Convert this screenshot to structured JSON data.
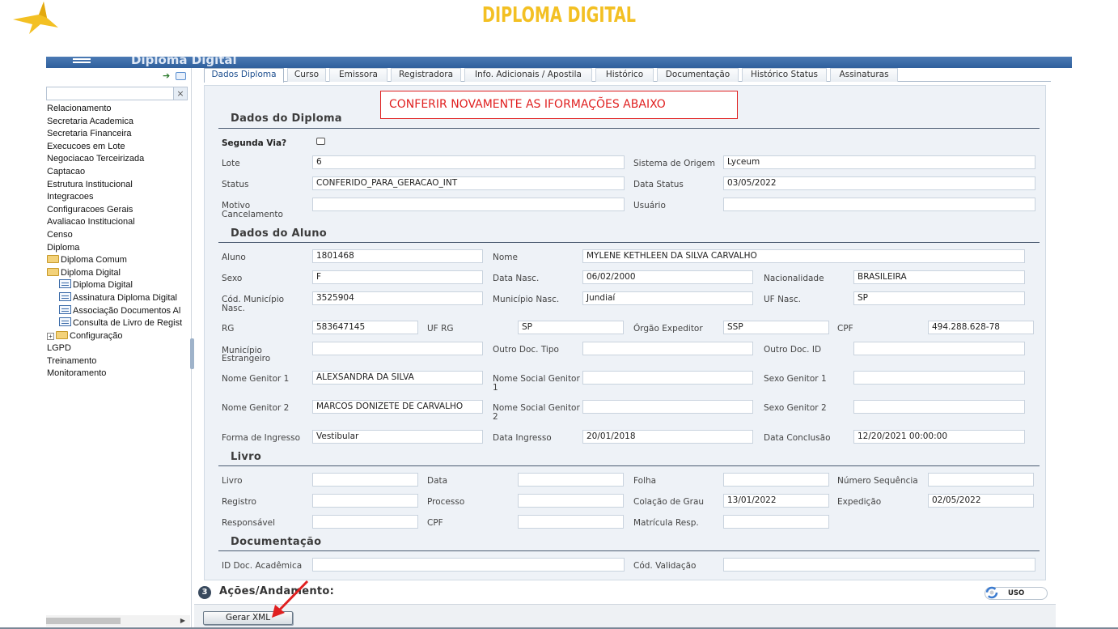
{
  "header": {
    "slide_title": "DIPLOMA DIGITAL",
    "app_title": "Diploma Digital",
    "accent_color": "#f3c023",
    "appbar_color": "#3a6aa8"
  },
  "sidebar": {
    "items": [
      "Relacionamento",
      "Secretaria Academica",
      "Secretaria Financeira",
      "Execucoes em Lote",
      "Negociacao Terceirizada",
      "Captacao",
      "Estrutura Institucional",
      "Integracoes",
      "Configuracoes Gerais",
      "Avaliacao Institucional",
      "Censo",
      "Diploma"
    ],
    "diploma_children": {
      "comum": "Diploma Comum",
      "digital": "Diploma Digital",
      "digital_children": [
        "Diploma Digital",
        "Assinatura Diploma Digital",
        "Associação Documentos Al",
        "Consulta de Livro de Regist"
      ],
      "configuracao": "Configuração"
    },
    "after_items": [
      "LGPD",
      "Treinamento",
      "Monitoramento"
    ]
  },
  "tabs": [
    "Dados Diploma",
    "Curso",
    "Emissora",
    "Registradora",
    "Info. Adicionais / Apostila",
    "Histórico",
    "Documentação",
    "Histórico Status",
    "Assinaturas"
  ],
  "notice": "CONFERIR NOVAMENTE AS IFORMAÇÕES ABAIXO",
  "dados_diploma": {
    "title": "Dados do Diploma",
    "segunda_via_label": "Segunda Via?",
    "segunda_via_checked": false,
    "lote_label": "Lote",
    "lote": "6",
    "sistema_origem_label": "Sistema de Origem",
    "sistema_origem": "Lyceum",
    "status_label": "Status",
    "status": "CONFERIDO_PARA_GERACAO_INT",
    "data_status_label": "Data Status",
    "data_status": "03/05/2022",
    "motivo_label_1": "Motivo",
    "motivo_label_2": "Cancelamento",
    "motivo": "",
    "usuario_label": "Usuário",
    "usuario": ""
  },
  "dados_aluno": {
    "title": "Dados do Aluno",
    "aluno_label": "Aluno",
    "aluno": "1801468",
    "nome_label": "Nome",
    "nome": "MYLENE KETHLEEN DA SILVA CARVALHO",
    "sexo_label": "Sexo",
    "sexo": "F",
    "data_nasc_label": "Data Nasc.",
    "data_nasc": "06/02/2000",
    "nacionalidade_label": "Nacionalidade",
    "nacionalidade": "BRASILEIRA",
    "cod_mun_label_1": "Cód. Município",
    "cod_mun_label_2": "Nasc.",
    "cod_mun": "3525904",
    "mun_nasc_label": "Município Nasc.",
    "mun_nasc": "Jundiaí",
    "uf_nasc_label": "UF Nasc.",
    "uf_nasc": "SP",
    "rg_label": "RG",
    "rg": "583647145",
    "uf_rg_label": "UF RG",
    "uf_rg": "SP",
    "orgao_label": "Órgão Expeditor",
    "orgao": "SSP",
    "cpf_label": "CPF",
    "cpf": "494.288.628-78",
    "mun_estr_label_1": "Município",
    "mun_estr_label_2": "Estrangeiro",
    "mun_estr": "",
    "outro_tipo_label": "Outro Doc. Tipo",
    "outro_tipo": "",
    "outro_id_label": "Outro Doc. ID",
    "outro_id": "",
    "genitor1_label": "Nome Genitor 1",
    "genitor1": "ALEXSANDRA DA SILVA",
    "social1_label_1": "Nome Social Genitor",
    "social1_label_2": "1",
    "social1": "",
    "sexo_g1_label": "Sexo Genitor 1",
    "sexo_g1": "",
    "genitor2_label": "Nome Genitor 2",
    "genitor2": "MARCOS DONIZETE DE CARVALHO",
    "social2_label_1": "Nome Social Genitor",
    "social2_label_2": "2",
    "social2": "",
    "sexo_g2_label": "Sexo Genitor 2",
    "sexo_g2": "",
    "ingresso_label": "Forma de Ingresso",
    "ingresso": "Vestibular",
    "data_ingresso_label": "Data Ingresso",
    "data_ingresso": "20/01/2018",
    "data_conclusao_label": "Data Conclusão",
    "data_conclusao": "12/20/2021 00:00:00"
  },
  "livro": {
    "title": "Livro",
    "livro_label": "Livro",
    "livro": "",
    "data_label": "Data",
    "data": "",
    "folha_label": "Folha",
    "folha": "",
    "num_seq_label": "Número Sequência",
    "num_seq": "",
    "registro_label": "Registro",
    "registro": "",
    "processo_label": "Processo",
    "processo": "",
    "colacao_label": "Colação de Grau",
    "colacao": "13/01/2022",
    "expedicao_label": "Expedição",
    "expedicao": "02/05/2022",
    "responsavel_label": "Responsável",
    "responsavel": "",
    "cpf_label": "CPF",
    "cpf": "",
    "matricula_label": "Matrícula Resp.",
    "matricula": ""
  },
  "documentacao": {
    "title": "Documentação",
    "id_doc_label": "ID Doc. Acadêmica",
    "id_doc": "",
    "cod_val_label": "Cód. Validação",
    "cod_val": ""
  },
  "acoes": {
    "number": "3",
    "title": "Ações/Andamento:",
    "uso_label": "USO",
    "gerar_xml": "Gerar XML"
  }
}
